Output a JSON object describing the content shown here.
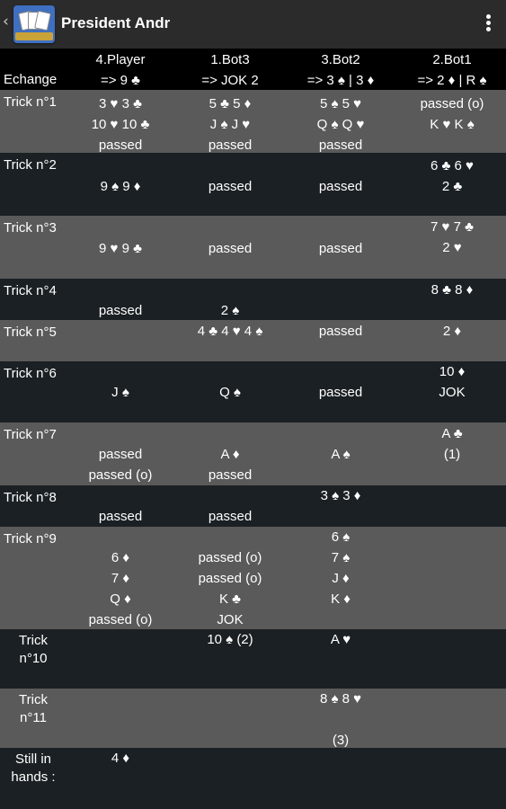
{
  "topbar": {
    "back_glyph": "‹",
    "title": "President Andr"
  },
  "colors": {
    "topbar": "#2b2b2b",
    "header_row": "#000000",
    "row_gray": "#5a5a5a",
    "row_dark": "#1b2024"
  },
  "headers": {
    "players": [
      "4.Player",
      "1.Bot3",
      "3.Bot2",
      "2.Bot1"
    ]
  },
  "exchange": {
    "label": "Echange",
    "cells": [
      "=> 9 ♣",
      "=> JOK 2",
      "=> 3 ♠ | 3 ♦",
      "=> 2 ♦ | R ♠"
    ]
  },
  "tricks": [
    {
      "label": "Trick n°1",
      "cols": [
        [
          "3 ♥ 3 ♣",
          "10 ♥ 10 ♣",
          "passed"
        ],
        [
          "5 ♣ 5 ♦",
          "J ♠ J ♥",
          "passed"
        ],
        [
          "5 ♠ 5 ♥",
          "Q ♠ Q ♥",
          "passed"
        ],
        [
          "passed (o)",
          "K ♥ K ♠"
        ]
      ]
    },
    {
      "label": "Trick n°2",
      "cols": [
        [
          "9 ♠ 9 ♦"
        ],
        [
          "passed"
        ],
        [
          "passed"
        ],
        [
          "6 ♣ 6 ♥",
          "2 ♣"
        ]
      ]
    },
    {
      "label": "Trick n°3",
      "cols": [
        [
          "9 ♥ 9 ♣"
        ],
        [
          "passed"
        ],
        [
          "passed"
        ],
        [
          "7 ♥ 7 ♣",
          "2 ♥"
        ]
      ]
    },
    {
      "label": "Trick n°4",
      "cols": [
        [
          "passed"
        ],
        [
          "2 ♠"
        ],
        [],
        [
          "8 ♣ 8 ♦"
        ]
      ]
    },
    {
      "label": "Trick n°5",
      "cols": [
        [],
        [
          "4 ♣ 4 ♥ 4 ♠"
        ],
        [
          "passed"
        ],
        [
          "2 ♦"
        ]
      ]
    },
    {
      "label": "Trick n°6",
      "cols": [
        [
          "J ♠"
        ],
        [
          "Q ♠"
        ],
        [
          "passed"
        ],
        [
          "10 ♦",
          "JOK"
        ]
      ]
    },
    {
      "label": "Trick n°7",
      "cols": [
        [
          "passed",
          "passed (o)"
        ],
        [
          "A ♦",
          "passed"
        ],
        [
          "A ♠"
        ],
        [
          "A ♣",
          "(1)"
        ]
      ]
    },
    {
      "label": "Trick n°8",
      "cols": [
        [
          "passed"
        ],
        [
          "passed"
        ],
        [
          "3 ♠ 3 ♦"
        ],
        []
      ]
    },
    {
      "label": "Trick n°9",
      "cols": [
        [
          "6 ♦",
          "7 ♦",
          "Q ♦",
          "passed (o)"
        ],
        [
          "passed (o)",
          "passed (o)",
          "K ♣",
          "JOK"
        ],
        [
          "6 ♠",
          "7 ♠",
          "J ♦",
          "K ♦"
        ],
        []
      ]
    },
    {
      "label": "Trick\nn°10",
      "cols": [
        [],
        [
          "10 ♠ (2)"
        ],
        [
          "A ♥"
        ],
        []
      ]
    },
    {
      "label": "Trick\nn°11",
      "cols": [
        [],
        [],
        [
          "8 ♠ 8 ♥",
          "",
          "(3)"
        ],
        []
      ]
    },
    {
      "label": "Still in\nhands :",
      "cols": [
        [
          "4 ♦"
        ],
        [],
        [],
        []
      ]
    }
  ]
}
